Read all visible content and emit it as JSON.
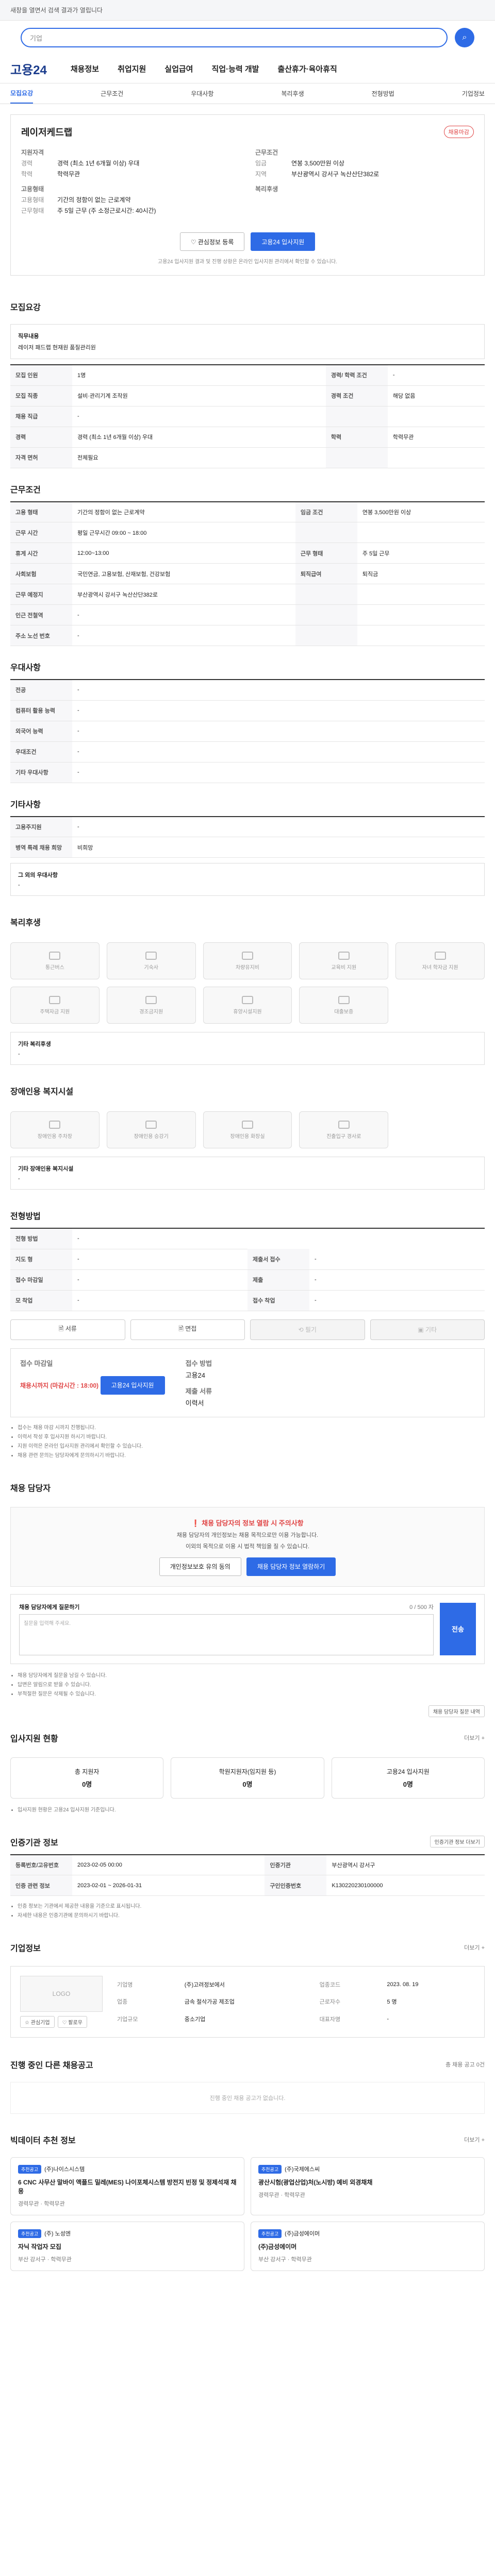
{
  "topbar": {
    "notice": "새창을 열면서 검색 결과가 열립니다"
  },
  "search": {
    "placeholder": "기업",
    "btn": "⌕"
  },
  "gnb": {
    "logo": "고용24",
    "menus": [
      "채용정보",
      "취업지원",
      "실업급여",
      "직업·능력 개발",
      "출산휴가·육아휴직"
    ]
  },
  "subnav": {
    "items": [
      "모집요강",
      "근무조건",
      "우대사항",
      "복리후생",
      "전형방법",
      "기업정보"
    ]
  },
  "company": {
    "name": "레이저케드랩",
    "badge": "채용마감"
  },
  "summary": {
    "left_title": "지원자격",
    "left_rows": [
      {
        "k": "경력",
        "v": "경력 (최소 1년 6개월 이상) 우대"
      },
      {
        "k": "학력",
        "v": "학력무관"
      }
    ],
    "right_title": "근무조건",
    "right_rows": [
      {
        "k": "임금",
        "v": "연봉 3,500만원 이상"
      },
      {
        "k": "지역",
        "v": "부산광역시 강서구 녹산산단382로"
      }
    ],
    "left2_title": "고용형태",
    "left2_rows": [
      {
        "k": "고용형태",
        "v": "기간의 정함이 없는 근로계약"
      },
      {
        "k": "근무형태",
        "v": "주 5일 근무 (주 소정근로시간: 40시간)"
      }
    ],
    "right2_title": "복리후생",
    "right2_rows": []
  },
  "actions": {
    "fav": "♡ 관심정보 등록",
    "apply": "고용24 입사지원"
  },
  "actions_note": "고용24 입사지원 결과 및 진행 상황은 온라인 입사지원 관리에서 확인할 수 있습니다.",
  "sec": {
    "recruit": "모집요강",
    "cond": "근무조건",
    "pref": "우대사항",
    "etc": "기타사항",
    "welfare": "복리후생",
    "disab": "장애인용 복지시설",
    "method": "전형방법",
    "manager": "채용 담당자",
    "stats": "입사지원 현황",
    "corp": "인증기관 정보",
    "corpinfo": "기업정보",
    "other": "진행 중인 다른 채용공고",
    "similar": "빅데이터 추천 정보"
  },
  "recruit": {
    "job_label": "직무내용",
    "job_value": "레이저 패드랩 현재원 품질관리원",
    "rows": [
      [
        "모집 인원",
        "1명",
        "경력/ 학력 조건",
        "-"
      ],
      [
        "모집 직종",
        "설비·관리기계 조작원",
        "경력 조건",
        "해당 없음"
      ],
      [
        "채용 직급",
        "-",
        "",
        ""
      ],
      [
        "경력",
        "경력 (최소 1년 6개월 이상) 우대",
        "학력",
        "학력무관"
      ],
      [
        "자격 면허",
        "전체필요",
        "",
        ""
      ]
    ]
  },
  "cond": {
    "rows": [
      [
        "고용 형태",
        "기간의 정함이 없는 근로계약",
        "임금 조건",
        "연봉 3,500만원 이상"
      ],
      [
        "근무 시간",
        "평일 근무시간 09:00 ~ 18:00",
        "",
        ""
      ],
      [
        "휴게 시간",
        "12:00~13:00",
        "근무 형태",
        "주 5일 근무"
      ],
      [
        "사회보험",
        "국민연금, 고용보험, 산재보험, 건강보험",
        "퇴직급여",
        "퇴직금"
      ],
      [
        "근무 예정지",
        "부산광역시 강서구 녹산산단382로",
        "",
        ""
      ],
      [
        "인근 전철역",
        "-",
        "",
        ""
      ],
      [
        "주소 노선 번호",
        "-",
        "",
        ""
      ]
    ]
  },
  "pref": {
    "rows": [
      [
        "전공",
        "-"
      ],
      [
        "컴퓨터 활용 능력",
        "-"
      ],
      [
        "외국어 능력",
        "-"
      ],
      [
        "우대조건",
        "-"
      ],
      [
        "기타 우대사항",
        "-"
      ]
    ]
  },
  "etc": {
    "rows": [
      [
        "고용주지원",
        "-"
      ],
      [
        "병역 특례 채용 희망",
        "비희망"
      ]
    ],
    "note_label": "그 외의 우대사항",
    "note": "-"
  },
  "welfare": {
    "items": [
      "통근버스",
      "기숙사",
      "차량유지비",
      "교육비 지원",
      "자녀 학자금 지원",
      "주택자금 지원",
      "경조금지원",
      "휴양시설지원",
      "대출보증"
    ],
    "other_label": "기타 복리후생",
    "other": "-"
  },
  "disab": {
    "items": [
      "장애인용 주차장",
      "장애인용 승강기",
      "장애인용 화장실",
      "진출입구 경사로"
    ],
    "other_label": "기타 장애인용 복지시설",
    "other": "-"
  },
  "method": {
    "rows": [
      [
        "전형 방법",
        "-"
      ],
      [
        "지도 형",
        "-",
        "제출서 접수",
        "-"
      ],
      [
        "접수 마감일",
        "-",
        "제출",
        "-"
      ],
      [
        "모 착업",
        "-",
        "접수 착업",
        "-"
      ]
    ],
    "btns": [
      "🗎 서류",
      "🗎 면접",
      "⟲ 필기",
      "▣ 기타"
    ]
  },
  "apply": {
    "title1": "접수 마감일",
    "val1": "채용시까지 (마감시간 : 18:00)",
    "title2": "접수 방법",
    "val2": "고용24",
    "btn": "고용24 입사지원",
    "title3": "제출 서류",
    "val3": "이력서"
  },
  "apply_notes": [
    "접수는 채용 마감 시까지 진행됩니다.",
    "이력서 작성 후 입사지원 하시기 바랍니다.",
    "지원 이력은 온라인 입사지원 관리에서 확인할 수 있습니다.",
    "채용 관련 문의는 담당자에게 문의하시기 바랍니다."
  ],
  "manager": {
    "alert_title": "❗ 채용 담당자의 정보 열람 시 주의사항",
    "alert_body": "채용 담당자의 개인정보는 채용 목적으로만 이용 가능합니다.",
    "alert_body2": "이외의 목적으로 이용 시 법적 책임을 질 수 있습니다.",
    "btn1": "개인정보보호 유의 동의",
    "btn2": "채용 담당자 정보 열람하기",
    "q_title": "채용 담당자에게 질문하기",
    "q_count": "0 / 500 자",
    "q_placeholder": "질문을 입력해 주세요.",
    "q_send": "전송",
    "q_notes": [
      "채용 담당자에게 질문을 남길 수 있습니다.",
      "답변은 알림으로 받을 수 있습니다.",
      "부적절한 질문은 삭제될 수 있습니다."
    ],
    "q_btn": "채용 담당자 질문 내역"
  },
  "stats": {
    "more": "더보기 +",
    "items": [
      {
        "label": "총 지원자",
        "val": "0명"
      },
      {
        "label": "학원지원자(임지원 등)",
        "val": "0명"
      },
      {
        "label": "고용24 입사지원",
        "val": "0명"
      }
    ],
    "note": "입사지원 현황은 고용24 입사지원 기준입니다."
  },
  "corp": {
    "chip": "인증기관 정보 더보기",
    "rows": [
      [
        "등록번호/고유번호",
        "2023-02-05 00:00",
        "인증기관",
        "부산광역시 강서구"
      ],
      [
        "인증 관련 정보",
        "2023-02-01 ~ 2026-01-31",
        "구인인증번호",
        "K130220230100000"
      ]
    ],
    "note": "인증 정보는 기관에서 제공한 내용을 기준으로 표시됩니다.",
    "note2": "자세한 내용은 인증기관에 문의하시기 바랍니다."
  },
  "corpinfo": {
    "more": "더보기 +",
    "logo": "LOGO",
    "rows": [
      [
        "기업명",
        "(주)고려정보에서",
        "업종코드",
        "2023. 08. 19"
      ],
      [
        "업종",
        "금속 절삭가공 제조업",
        "근로자수",
        "5 명"
      ],
      [
        "기업규모",
        "중소기업",
        "대표자명",
        "-"
      ]
    ],
    "btn1": "☆ 관심기업",
    "btn2": "♡ 팔로우"
  },
  "other": {
    "note": "총 채용 공고 0건",
    "empty": "진행 중인 채용 공고가 없습니다."
  },
  "similar": {
    "more": "더보기 +",
    "jobs": [
      {
        "badge": "추천공고",
        "company": "(주)나이스시스템",
        "title": "6 CNC 사무산 말바이 액플드 밀레(MES) 나이포체시스템 방전지 빈정 및 정제석재 채용",
        "meta": "경력무관 · 학력무관"
      },
      {
        "badge": "추천공고",
        "company": "(주)국제에스씨",
        "title": "광산시험(광업산업)처(노시방) 예비 외경채채",
        "meta": "경력무관 · 학력무관"
      },
      {
        "badge": "추천공고",
        "company": "(주) 노성엔",
        "title": "자닉 작업자 모집",
        "meta": "부산 강서구 · 학력무관"
      },
      {
        "badge": "추천공고",
        "company": "(주)금성에이머",
        "title": "(주)금성에이머",
        "meta": "부산 강서구 · 학력무관"
      }
    ]
  }
}
